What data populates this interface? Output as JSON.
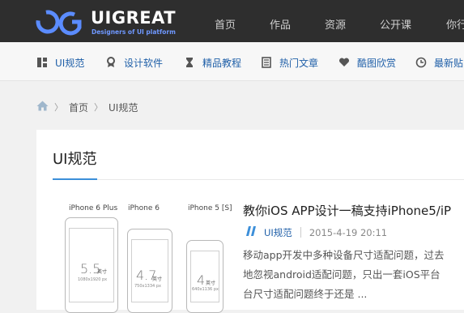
{
  "header": {
    "logo": {
      "name": "UIGREAT",
      "tagline": "Designers of UI platform"
    },
    "nav": [
      "首页",
      "作品",
      "资源",
      "公开课",
      "你行"
    ]
  },
  "subnav": [
    {
      "label": "UI规范",
      "icon": "grid-icon"
    },
    {
      "label": "设计软件",
      "icon": "ribbon-icon"
    },
    {
      "label": "精品教程",
      "icon": "hourglass-icon"
    },
    {
      "label": "热门文章",
      "icon": "document-icon"
    },
    {
      "label": "酷图欣赏",
      "icon": "heart-icon"
    },
    {
      "label": "最新贴",
      "icon": "clock-icon"
    }
  ],
  "breadcrumb": {
    "items": [
      "首页",
      "UI规范"
    ]
  },
  "section": {
    "title": "UI规范"
  },
  "article": {
    "title": "教你iOS APP设计一稿支持iPhone5/iP",
    "category": "UI规范",
    "date": "2015-4-19 20:11",
    "excerpt": [
      "移动app开发中多种设备尺寸适配问题，过去",
      "地忽视android适配问题，只出一套iOS平台",
      "台尺寸适配问题终于还是 ..."
    ],
    "image": {
      "phones": [
        {
          "label": "iPhone 6 Plus",
          "size": "5.5",
          "unit": "英寸",
          "resolution": "1080x1920 px"
        },
        {
          "label": "iPhone 6",
          "size": "4.7",
          "unit": "英寸",
          "resolution": "750x1334 px"
        },
        {
          "label": "iPhone 5 [S]",
          "size": "4",
          "unit": "英寸",
          "resolution": "640x1136 px"
        }
      ]
    }
  },
  "colors": {
    "accent": "#3c8fd9",
    "link": "#1f5fa8",
    "header_bg": "#2e2e2e"
  }
}
